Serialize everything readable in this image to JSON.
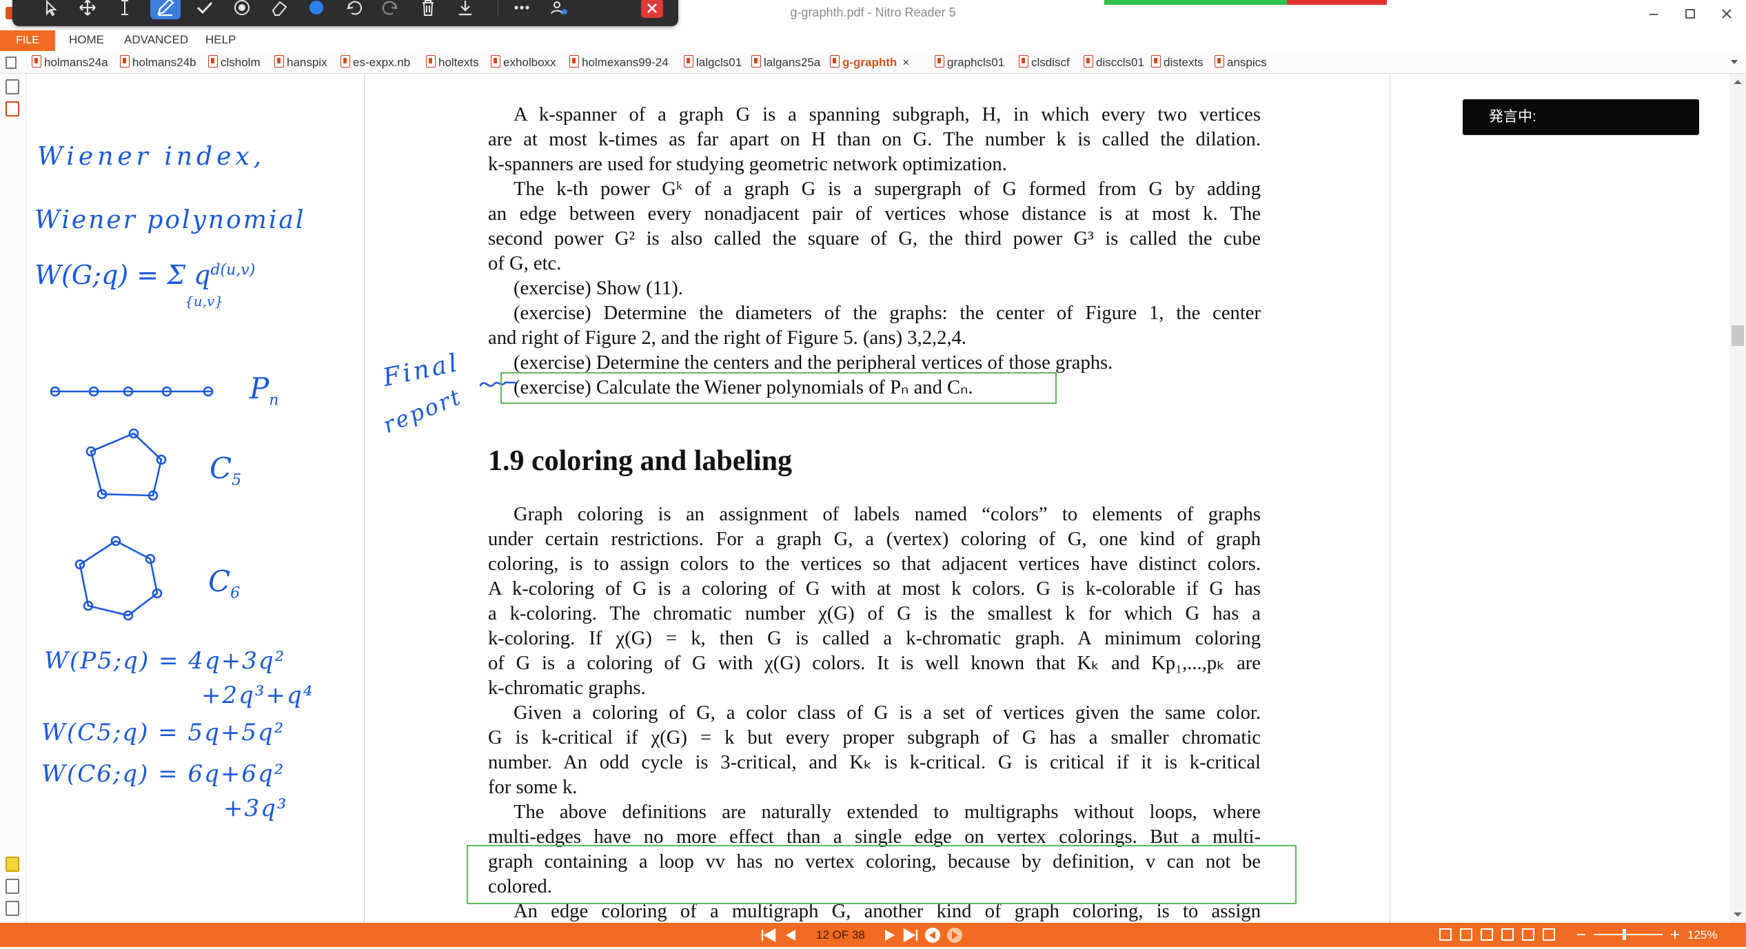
{
  "window": {
    "title": "g-graphth.pdf - Nitro Reader 5"
  },
  "toolbar": {
    "icons": [
      "cursor-arrow-icon",
      "move-icon",
      "text-cursor-icon",
      "pen-icon",
      "check-icon",
      "stamp-icon",
      "eraser-icon",
      "color-dot-icon",
      "undo-icon",
      "redo-icon",
      "trash-icon",
      "download-icon",
      "more-icon",
      "pen-settings-icon",
      "close-icon"
    ],
    "colors": {
      "bg": "#2d2d30",
      "active": "#3c7ee0",
      "close": "#e13a3a",
      "dot": "#2f7fe8"
    }
  },
  "menu": {
    "file": "FILE",
    "home": "HOME",
    "advanced": "ADVANCED",
    "help": "HELP"
  },
  "tabs": [
    {
      "label": "holmans24a"
    },
    {
      "label": "holmans24b"
    },
    {
      "label": "clsholm"
    },
    {
      "label": "hanspix"
    },
    {
      "label": "es-expx.nb"
    },
    {
      "label": "holtexts"
    },
    {
      "label": "exholboxx"
    },
    {
      "label": "holmexans99-24"
    },
    {
      "label": "lalgcls01"
    },
    {
      "label": "lalgans25a"
    },
    {
      "label": "g-graphth",
      "active": true
    },
    {
      "label": "graphcls01"
    },
    {
      "label": "clsdiscf"
    },
    {
      "label": "disccls01"
    },
    {
      "label": "distexts"
    },
    {
      "label": "anspics"
    }
  ],
  "tab_close": "×",
  "speech": {
    "label": "発言中:"
  },
  "ink_color": "#1a58d8",
  "annotations": {
    "left": {
      "wiener_index": "Wiener index,",
      "wiener_polynomial": "Wiener polynomial",
      "formula_main": "W(G;q) = Σ q",
      "formula_exp": "d(u,v)",
      "formula_sub": "{u,v}",
      "pn": "P",
      "pn_sub": "n",
      "c5": "C",
      "c5_sub": "5",
      "c6": "C",
      "c6_sub": "6",
      "w_p5_line1": "W(P5;q) = 4q+3q²",
      "w_p5_line2": "+2q³+q⁴",
      "w_c5": "W(C5;q) = 5q+5q²",
      "w_c6_line1": "W(C6;q) = 6q+6q²",
      "w_c6_line2": "+3q³"
    },
    "margin": {
      "line1": "Final",
      "line2": "report"
    }
  },
  "document": {
    "lines": [
      "A k-spanner of a graph G is a spanning subgraph, H, in which every two vertices",
      "are at most k-times as far apart on H than on G. The number k is called the dilation.",
      "k-spanners are used for studying geometric network optimization.",
      "The k-th power Gᵏ of a graph G is a supergraph of G formed from G by adding",
      "an edge between every nonadjacent pair of vertices whose distance is at most k. The",
      "second power G² is also called the square of G, the third power G³ is called the cube",
      "of G, etc.",
      "(exercise) Show (11).",
      "(exercise) Determine the diameters of the graphs: the center of Figure 1, the center",
      "and right of Figure 2, and the right of Figure 5.   (ans) 3,2,2,4.",
      "(exercise) Determine the centers and the peripheral vertices of those graphs.",
      "(exercise) Calculate the Wiener polynomials of Pₙ and Cₙ."
    ],
    "section_heading": "1.9   coloring and labeling",
    "lines2": [
      "Graph coloring is an assignment of labels named “colors” to elements of graphs",
      "under certain restrictions. For a graph G, a (vertex) coloring of G, one kind of graph",
      "coloring, is to assign colors to the vertices so that adjacent vertices have distinct colors.",
      "A k-coloring of G is a coloring of G with at most k colors. G is k-colorable if G has",
      "a k-coloring. The chromatic number χ(G) of G is the smallest k for which G has a",
      "k-coloring. If χ(G) = k, then G is called a k-chromatic graph. A minimum coloring",
      "of G is a coloring of G with χ(G) colors. It is well known that Kₖ and Kp₁,...,pₖ are",
      "k-chromatic graphs.",
      "Given a coloring of G, a color class of G is a set of vertices given the same color.",
      "G is k-critical if χ(G) = k but every proper subgraph of G has a smaller chromatic",
      "number. An odd cycle is 3-critical, and Kₖ is k-critical. G is critical if it is k-critical",
      "for some k.",
      "The above definitions are naturally extended to multigraphs without loops, where",
      "multi-edges have no more effect than a single edge on vertex colorings. But a multi-",
      "graph containing a loop vv has no vertex coloring, because by definition, v can not be",
      "colored.",
      "An edge coloring of a multigraph G, another kind of graph coloring, is to assign"
    ]
  },
  "status": {
    "page_indicator": "12 OF 38",
    "zoom": "125%"
  }
}
